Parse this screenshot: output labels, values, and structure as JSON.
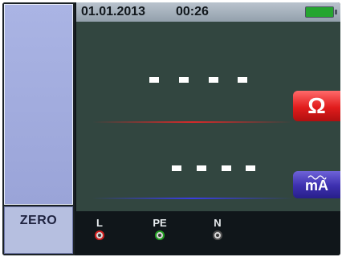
{
  "status": {
    "date": "01.01.2013",
    "time": "00:26",
    "battery_icon": "battery-full-icon",
    "battery_color": "#25a530"
  },
  "softkeys": {
    "zero_label": "ZERO"
  },
  "readings": {
    "resistance": {
      "value_display": "- - - -",
      "unit": "Ω",
      "unit_color": "#e11c1c"
    },
    "current": {
      "value_display": "- - - -",
      "unit": "mA",
      "unit_color": "#3c2fae"
    }
  },
  "terminals": [
    {
      "label": "L",
      "ring_color": "#d62020"
    },
    {
      "label": "PE",
      "ring_color": "#22a022"
    },
    {
      "label": "N",
      "ring_color": "#505050"
    }
  ]
}
